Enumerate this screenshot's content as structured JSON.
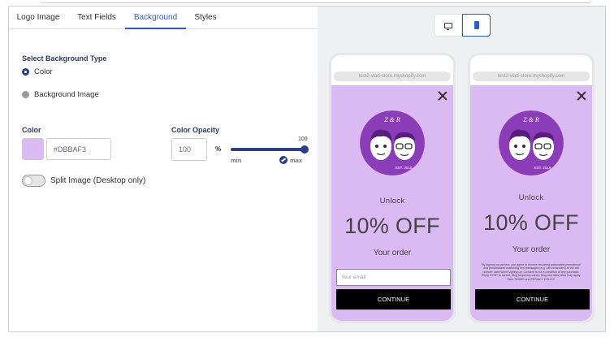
{
  "tabs": [
    {
      "label": "Logo Image"
    },
    {
      "label": "Text Fields"
    },
    {
      "label": "Background"
    },
    {
      "label": "Styles"
    }
  ],
  "background_type": {
    "title": "Select Background Type",
    "options": [
      {
        "label": "Color",
        "selected": true
      },
      {
        "label": "Background Image",
        "selected": false
      }
    ]
  },
  "color": {
    "label": "Color",
    "swatch": "#DBBAF3",
    "value": "#DBBAF3"
  },
  "opacity": {
    "label": "Color Opacity",
    "value": "100",
    "unit": "%",
    "slider_value": 100,
    "slider_max_label": "100",
    "min_label": "min",
    "max_label": "max"
  },
  "split_image": {
    "label": "Split Image (Desktop only)",
    "enabled": false
  },
  "device_switch": {
    "options": [
      "desktop-icon",
      "mobile-icon"
    ],
    "selected": "mobile"
  },
  "preview": {
    "url": "test2-vlad-store.myshopify.com",
    "background": "#dbbaf3",
    "logo_text": "Z & R",
    "logo_est": "EST. 2018",
    "unlock": "Unlock",
    "headline": "10% OFF",
    "subtext": "Your order",
    "email_placeholder": "Your email",
    "cta": "CONTINUE",
    "legal": "By signing up via text, you agree to receive recurring automated promotional and personalized marketing text messages (e.g. cart reminders) at the cell number used when signing up. Consent is not a condition of any purchase. Reply STOP to cancel. Msg frequency varies. Msg and data rates may apply. View TERMS and PRIVACY POLICY."
  }
}
